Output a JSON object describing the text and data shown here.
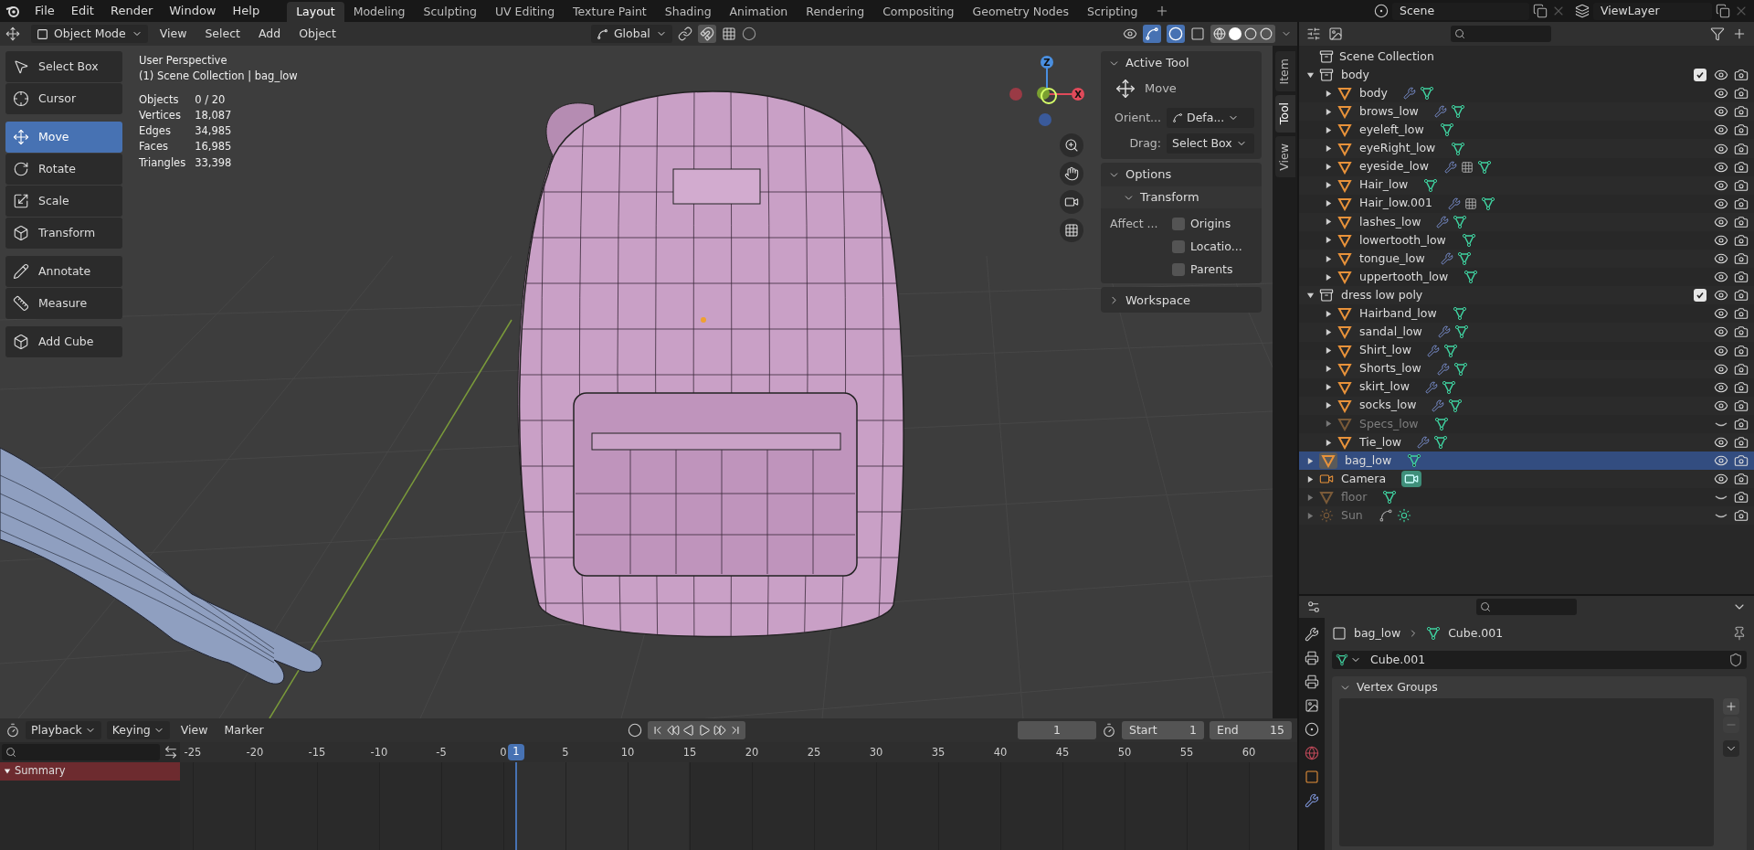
{
  "top_menu": [
    "File",
    "Edit",
    "Render",
    "Window",
    "Help"
  ],
  "workspace_tabs": [
    {
      "label": "Layout",
      "selected": true
    },
    {
      "label": "Modeling",
      "selected": false
    },
    {
      "label": "Sculpting",
      "selected": false
    },
    {
      "label": "UV Editing",
      "selected": false
    },
    {
      "label": "Texture Paint",
      "selected": false
    },
    {
      "label": "Shading",
      "selected": false
    },
    {
      "label": "Animation",
      "selected": false
    },
    {
      "label": "Rendering",
      "selected": false
    },
    {
      "label": "Compositing",
      "selected": false
    },
    {
      "label": "Geometry Nodes",
      "selected": false
    },
    {
      "label": "Scripting",
      "selected": false
    }
  ],
  "scene": "Scene",
  "view_layer": "ViewLayer",
  "viewport_header": {
    "mode": "Object Mode",
    "menus": [
      "View",
      "Select",
      "Add",
      "Object"
    ],
    "orientation": "Global"
  },
  "tool_groups": [
    [
      {
        "label": "Select Box",
        "selected": false
      },
      {
        "label": "Cursor",
        "selected": false
      }
    ],
    [
      {
        "label": "Move",
        "selected": true
      },
      {
        "label": "Rotate",
        "selected": false
      },
      {
        "label": "Scale",
        "selected": false
      },
      {
        "label": "Transform",
        "selected": false
      }
    ],
    [
      {
        "label": "Annotate",
        "selected": false
      },
      {
        "label": "Measure",
        "selected": false
      }
    ],
    [
      {
        "label": "Add Cube",
        "selected": false
      }
    ]
  ],
  "overlay": {
    "view": "User Perspective",
    "context": "(1) Scene Collection | bag_low",
    "stats": [
      {
        "label": "Objects",
        "value": "0 / 20"
      },
      {
        "label": "Vertices",
        "value": "18,087"
      },
      {
        "label": "Edges",
        "value": "34,985"
      },
      {
        "label": "Faces",
        "value": "16,985"
      },
      {
        "label": "Triangles",
        "value": "33,398"
      }
    ]
  },
  "gizmo_labels": [
    "Z",
    "X"
  ],
  "sidebar_tabs": [
    {
      "label": "Item",
      "selected": false
    },
    {
      "label": "Tool",
      "selected": true
    },
    {
      "label": "View",
      "selected": false
    }
  ],
  "tool_panel": {
    "active_tool": {
      "title": "Active Tool",
      "expanded": true,
      "tool": "Move",
      "orient_label": "Orient...",
      "orient_value": "Defa...",
      "drag_label": "Drag:",
      "drag_value": "Select Box"
    },
    "options": {
      "title": "Options",
      "expanded": true,
      "transform": "Transform",
      "affect_label": "Affect ...",
      "checkboxes": [
        {
          "label": "Origins",
          "checked": false
        },
        {
          "label": "Locatio...",
          "checked": false
        },
        {
          "label": "Parents",
          "checked": false
        }
      ]
    },
    "workspace": {
      "title": "Workspace",
      "expanded": false
    }
  },
  "outliner": {
    "root": "Scene Collection",
    "items": [
      {
        "name": "body",
        "kind": "collection",
        "expanded": true,
        "checked": true,
        "visible": true,
        "children": [
          {
            "name": "body",
            "kind": "mesh",
            "expanded": false,
            "visible": true,
            "selected": false,
            "modifier": true,
            "particles": false
          },
          {
            "name": "brows_low",
            "kind": "mesh",
            "expanded": false,
            "visible": true,
            "selected": false,
            "modifier": true,
            "particles": false
          },
          {
            "name": "eyeleft_low",
            "kind": "mesh",
            "expanded": false,
            "visible": true,
            "selected": false,
            "modifier": false,
            "particles": false
          },
          {
            "name": "eyeRight_low",
            "kind": "mesh",
            "expanded": false,
            "visible": true,
            "selected": false,
            "modifier": false,
            "particles": false
          },
          {
            "name": "eyeside_low",
            "kind": "mesh",
            "expanded": false,
            "visible": true,
            "selected": false,
            "modifier": true,
            "particles": true
          },
          {
            "name": "Hair_low",
            "kind": "mesh",
            "expanded": false,
            "visible": true,
            "selected": false,
            "modifier": false,
            "particles": false
          },
          {
            "name": "Hair_low.001",
            "kind": "mesh",
            "expanded": false,
            "visible": true,
            "selected": false,
            "modifier": true,
            "particles": true
          },
          {
            "name": "lashes_low",
            "kind": "mesh",
            "expanded": false,
            "visible": true,
            "selected": false,
            "modifier": true,
            "particles": false
          },
          {
            "name": "lowertooth_low",
            "kind": "mesh",
            "expanded": false,
            "visible": true,
            "selected": false,
            "modifier": false,
            "particles": false
          },
          {
            "name": "tongue_low",
            "kind": "mesh",
            "expanded": false,
            "visible": true,
            "selected": false,
            "modifier": true,
            "particles": false
          },
          {
            "name": "uppertooth_low",
            "kind": "mesh",
            "expanded": false,
            "visible": true,
            "selected": false,
            "modifier": false,
            "particles": false
          }
        ]
      },
      {
        "name": "dress low poly",
        "kind": "collection",
        "expanded": true,
        "checked": true,
        "visible": true,
        "children": [
          {
            "name": "Hairband_low",
            "kind": "mesh",
            "expanded": false,
            "visible": true,
            "selected": false,
            "modifier": false,
            "particles": false
          },
          {
            "name": "sandal_low",
            "kind": "mesh",
            "expanded": false,
            "visible": true,
            "selected": false,
            "modifier": true,
            "particles": false
          },
          {
            "name": "Shirt_low",
            "kind": "mesh",
            "expanded": false,
            "visible": true,
            "selected": false,
            "modifier": true,
            "particles": false
          },
          {
            "name": "Shorts_low",
            "kind": "mesh",
            "expanded": false,
            "visible": true,
            "selected": false,
            "modifier": true,
            "particles": false
          },
          {
            "name": "skirt_low",
            "kind": "mesh",
            "expanded": false,
            "visible": true,
            "selected": false,
            "modifier": true,
            "particles": false
          },
          {
            "name": "socks_low",
            "kind": "mesh",
            "expanded": false,
            "visible": true,
            "selected": false,
            "modifier": true,
            "particles": false
          },
          {
            "name": "Specs_low",
            "kind": "mesh",
            "expanded": false,
            "visible": false,
            "selected": false,
            "modifier": false,
            "particles": false
          },
          {
            "name": "Tie_low",
            "kind": "mesh",
            "expanded": false,
            "visible": true,
            "selected": false,
            "modifier": true,
            "particles": false
          }
        ]
      },
      {
        "name": "bag_low",
        "kind": "mesh",
        "expanded": false,
        "visible": true,
        "selected": true,
        "modifier": false,
        "particles": false
      },
      {
        "name": "Camera",
        "kind": "camera",
        "expanded": false,
        "visible": true,
        "selected": false,
        "modifier": false,
        "particles": false
      },
      {
        "name": "floor",
        "kind": "mesh",
        "expanded": false,
        "visible": false,
        "selected": false,
        "modifier": false,
        "particles": false
      },
      {
        "name": "Sun",
        "kind": "light",
        "expanded": false,
        "visible": false,
        "selected": false,
        "modifier": false,
        "particles": false
      }
    ]
  },
  "properties": {
    "object": "bag_low",
    "data": "Cube.001",
    "data_field": "Cube.001",
    "panel": "Vertex Groups",
    "panel_expanded": true
  },
  "timeline": {
    "menus": [
      "Playback",
      "Keying",
      "View",
      "Marker"
    ],
    "current_frame": "1",
    "start_label": "Start",
    "start": "1",
    "end_label": "End",
    "end": "15",
    "ticks": [
      "-25",
      "-20",
      "-15",
      "-10",
      "-5",
      "0",
      "5",
      "10",
      "15",
      "20",
      "25",
      "30",
      "35",
      "40",
      "45",
      "50",
      "55",
      "60"
    ],
    "playhead": "1",
    "channel": "Summary"
  }
}
